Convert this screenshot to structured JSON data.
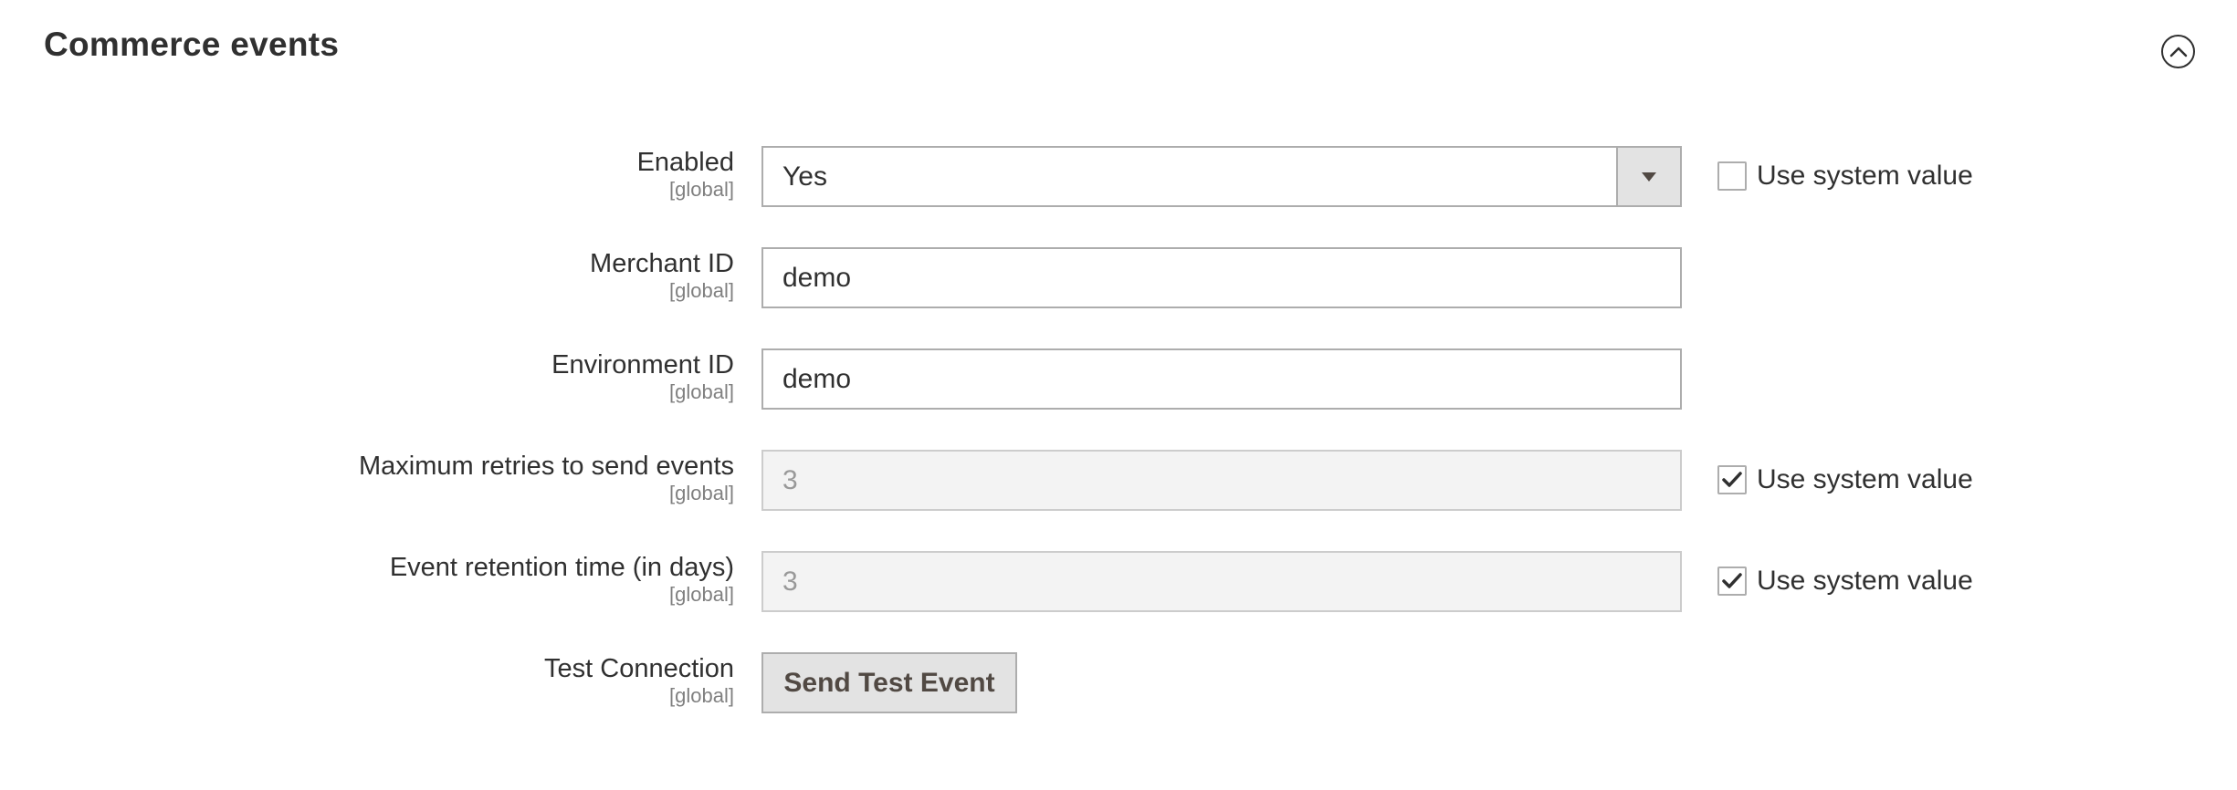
{
  "section": {
    "title": "Commerce events"
  },
  "fields": {
    "enabled": {
      "label": "Enabled",
      "scope": "[global]",
      "value": "Yes",
      "use_system_value_label": "Use system value",
      "use_system_value_checked": false
    },
    "merchant_id": {
      "label": "Merchant ID",
      "scope": "[global]",
      "value": "demo"
    },
    "environment_id": {
      "label": "Environment ID",
      "scope": "[global]",
      "value": "demo"
    },
    "max_retries": {
      "label": "Maximum retries to send events",
      "scope": "[global]",
      "value": "3",
      "use_system_value_label": "Use system value",
      "use_system_value_checked": true
    },
    "retention_time": {
      "label": "Event retention time (in days)",
      "scope": "[global]",
      "value": "3",
      "use_system_value_label": "Use system value",
      "use_system_value_checked": true
    },
    "test_connection": {
      "label": "Test Connection",
      "scope": "[global]",
      "button_label": "Send Test Event"
    }
  },
  "icons": {
    "collapse": "chevron-up-circle-icon",
    "select_arrow": "caret-down-icon",
    "checkmark": "checkmark-icon"
  },
  "colors": {
    "text": "#303030",
    "scope_text": "#808080",
    "border": "#adadad",
    "disabled_bg": "#f3f3f3",
    "button_bg": "#e3e3e3",
    "button_text": "#514943"
  }
}
